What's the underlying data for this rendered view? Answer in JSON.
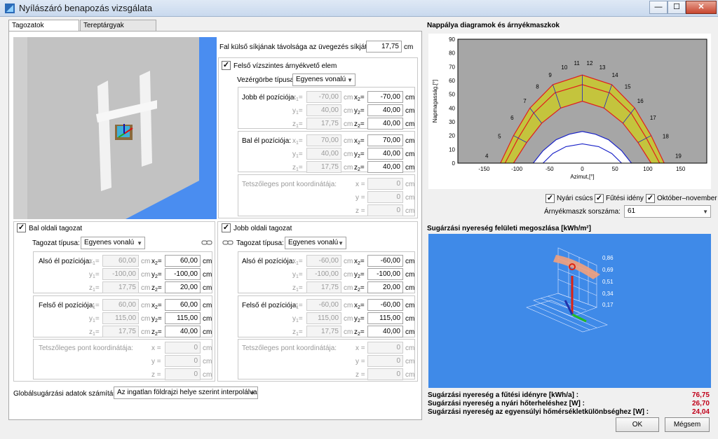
{
  "window": {
    "title": "Nyílászáró benapozás vizsgálata",
    "minimize": "—",
    "maximize": "☐",
    "close": "✕"
  },
  "tabs": [
    {
      "label": "Tagozatok geometriája"
    },
    {
      "label": "Tereptárgyak megadása"
    }
  ],
  "wall_distance": {
    "label": "Fal külső síkjának távolsága az üvegezés síkjától:",
    "value": "17,75",
    "unit": "cm"
  },
  "top": {
    "check_label": "Felső vízszintes árnyékvető elem",
    "curve_label": "Vezérgörbe típusa:",
    "curve_value": "Egyenes vonalú",
    "right_edge": {
      "label": "Jobb él pozíciója:",
      "x1": "-70,00",
      "y1": "40,00",
      "z1": "17,75",
      "x2": "-70,00",
      "y2": "40,00",
      "z2": "40,00"
    },
    "left_edge": {
      "label": "Bal él pozíciója:",
      "x1": "70,00",
      "y1": "40,00",
      "z1": "17,75",
      "x2": "70,00",
      "y2": "40,00",
      "z2": "40,00"
    },
    "arbitrary": {
      "label": "Tetszőleges pont koordinátája:",
      "x": "0",
      "y": "0",
      "z": "0"
    }
  },
  "left": {
    "check_label": "Bal oldali tagozat",
    "type_label": "Tagozat típusa:",
    "type_value": "Egyenes vonalú",
    "lower_edge": {
      "label": "Alsó él pozíciója:",
      "x1": "60,00",
      "y1": "-100,00",
      "z1": "17,75",
      "x2": "60,00",
      "y2": "-100,00",
      "z2": "20,00"
    },
    "upper_edge": {
      "label": "Felső él pozíciója:",
      "x1": "60,00",
      "y1": "115,00",
      "z1": "17,75",
      "x2": "60,00",
      "y2": "115,00",
      "z2": "40,00"
    },
    "arbitrary": {
      "label": "Tetszőleges pont koordinátája:",
      "x": "0",
      "y": "0",
      "z": "0"
    }
  },
  "right": {
    "check_label": "Jobb oldali tagozat",
    "type_label": "Tagozat típusa:",
    "type_value": "Egyenes vonalú",
    "lower_edge": {
      "label": "Alsó él pozíciója:",
      "x1": "-60,00",
      "y1": "-100,00",
      "z1": "17,75",
      "x2": "-60,00",
      "y2": "-100,00",
      "z2": "20,00"
    },
    "upper_edge": {
      "label": "Felső él pozíciója:",
      "x1": "-60,00",
      "y1": "115,00",
      "z1": "17,75",
      "x2": "-60,00",
      "y2": "115,00",
      "z2": "40,00"
    },
    "arbitrary": {
      "label": "Tetszőleges pont koordinátája:",
      "x": "0",
      "y": "0",
      "z": "0"
    }
  },
  "global_radiation": {
    "label": "Globálsugárzási adatok számítása:",
    "value": "Az ingatlan földrajzi helye szerint interpolálva"
  },
  "units": {
    "cm": "cm",
    "x1": "x",
    "y1": "y",
    "z1": "z",
    "eq": "=",
    "x": "x",
    "y": "y",
    "z": "z"
  },
  "sun_panel": {
    "title": "Nappálya diagramok és árnyékmaszkok",
    "chk_summer": "Nyári csúcs",
    "chk_heating": "Fűtési idény",
    "chk_oct_nov": "Október–november",
    "mask_label": "Árnyékmaszk sorszáma:",
    "mask_value": "61"
  },
  "chart_data": {
    "type": "line",
    "title": "",
    "xlabel": "Azimut,[°]",
    "ylabel": "Napmagasság,[°]",
    "xlim": [
      -190,
      190
    ],
    "ylim": [
      0,
      90
    ],
    "xticks": [
      -150,
      -100,
      -50,
      0,
      50,
      100,
      150
    ],
    "yticks": [
      0,
      10,
      20,
      30,
      40,
      50,
      60,
      70,
      80,
      90
    ],
    "hour_labels": [
      "4",
      "5",
      "6",
      "7",
      "8",
      "9",
      "10",
      "11",
      "12",
      "13",
      "14",
      "15",
      "16",
      "17",
      "18",
      "19"
    ],
    "series": [
      {
        "values": [
          [
            -125,
            0
          ],
          [
            -105,
            20
          ],
          [
            -80,
            40
          ],
          [
            -45,
            57
          ],
          [
            0,
            64
          ],
          [
            45,
            57
          ],
          [
            80,
            40
          ],
          [
            105,
            20
          ],
          [
            125,
            0
          ]
        ]
      },
      {
        "values": [
          [
            -118,
            0
          ],
          [
            -98,
            18
          ],
          [
            -75,
            36
          ],
          [
            -42,
            51
          ],
          [
            0,
            57
          ],
          [
            42,
            51
          ],
          [
            75,
            36
          ],
          [
            98,
            18
          ],
          [
            118,
            0
          ]
        ]
      },
      {
        "values": [
          [
            -105,
            0
          ],
          [
            -85,
            15
          ],
          [
            -62,
            29
          ],
          [
            -33,
            40
          ],
          [
            0,
            45
          ],
          [
            33,
            40
          ],
          [
            62,
            29
          ],
          [
            85,
            15
          ],
          [
            105,
            0
          ]
        ]
      },
      {
        "values": [
          [
            -75,
            0
          ],
          [
            -60,
            9
          ],
          [
            -40,
            17
          ],
          [
            -20,
            21
          ],
          [
            0,
            23
          ],
          [
            20,
            21
          ],
          [
            40,
            17
          ],
          [
            60,
            9
          ],
          [
            75,
            0
          ]
        ]
      },
      {
        "values": [
          [
            -60,
            0
          ],
          [
            -45,
            7
          ],
          [
            -25,
            12
          ],
          [
            0,
            14
          ],
          [
            25,
            12
          ],
          [
            45,
            7
          ],
          [
            60,
            0
          ]
        ]
      }
    ],
    "colors": {
      "background": "#a6a6a6",
      "band": "#c8c832",
      "red": "#e11d1d",
      "blue": "#1a23c8"
    }
  },
  "radiation_panel": {
    "title": "Sugárzási nyereség felületi megoszlása [kWh/m²]",
    "scale": [
      "0,86",
      "0,69",
      "0,51",
      "0,34",
      "0,17"
    ]
  },
  "results": [
    {
      "label": "Sugárzási nyereség a fűtési idényre [kWh/a] :",
      "value": "76,75"
    },
    {
      "label": "Sugárzási nyereség a nyári hőterheléshez [W] :",
      "value": "26,70"
    },
    {
      "label": "Sugárzási nyereség az egyensúlyi hőmérsékletkülönbséghez [W] :",
      "value": "24,04"
    }
  ],
  "buttons": {
    "ok": "OK",
    "cancel": "Mégsem"
  }
}
